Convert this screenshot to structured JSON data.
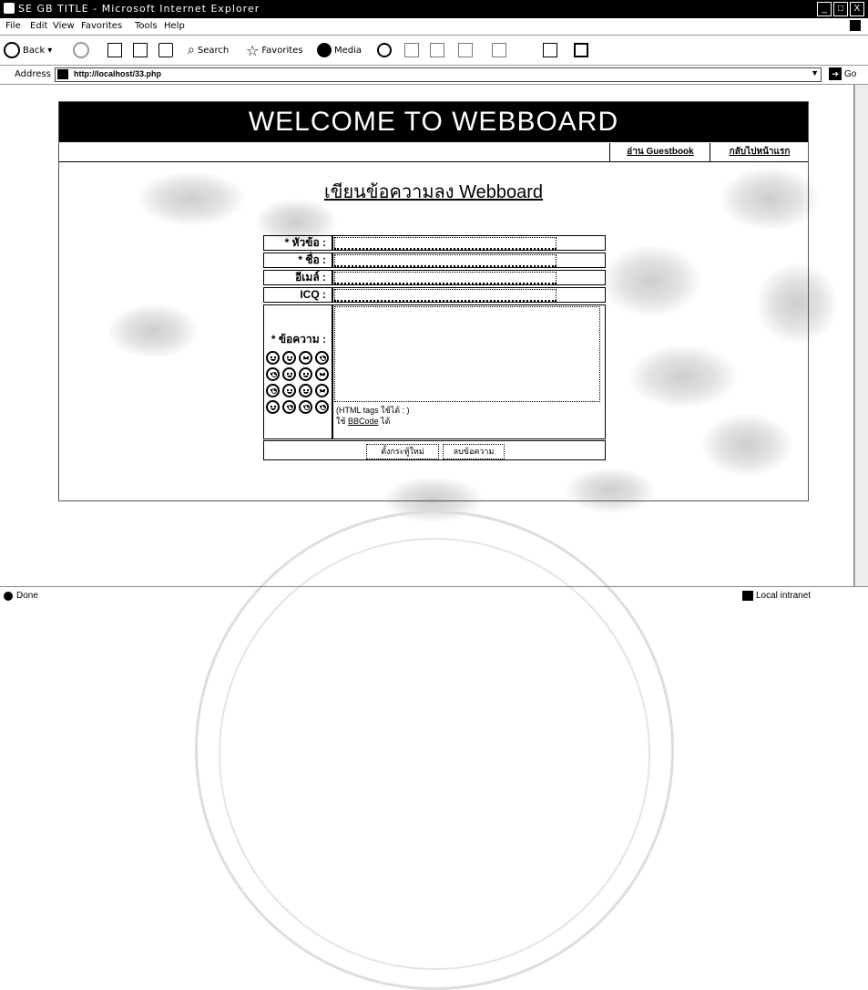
{
  "window": {
    "title": "SE GB TITLE - Microsoft Internet Explorer",
    "controls": [
      "_",
      "□",
      "X"
    ]
  },
  "menu": [
    "File",
    "Edit",
    "View",
    "Favorites",
    "Tools",
    "Help"
  ],
  "toolbar": {
    "back": "Back",
    "search": "Search",
    "favorites": "Favorites",
    "media": "Media"
  },
  "address": {
    "label": "Address",
    "url": "http://localhost/33.php",
    "go": "Go"
  },
  "page": {
    "banner": "WELCOME TO WEBBOARD",
    "nav": {
      "guestbook": "อ่าน Guestbook",
      "home": "กลับไปหน้าแรก"
    },
    "heading": "เขียนข้อความลง Webboard",
    "form": {
      "topic_label": "* หัวข้อ :",
      "name_label": "* ชื่อ :",
      "email_label": "อีเมล์ :",
      "icq_label": "ICQ :",
      "message_label": "* ข้อความ :",
      "html_note": "(HTML tags ใช้ได้ : )",
      "bbcode_prefix": "ใช้ ",
      "bbcode_link": "BBCode",
      "bbcode_suffix": " ได้",
      "reset_button": "ตั้งกระทู้ใหม่",
      "clear_button": "ลบข้อความ"
    }
  },
  "status": {
    "text": "Done",
    "zone": "Local intranet"
  }
}
